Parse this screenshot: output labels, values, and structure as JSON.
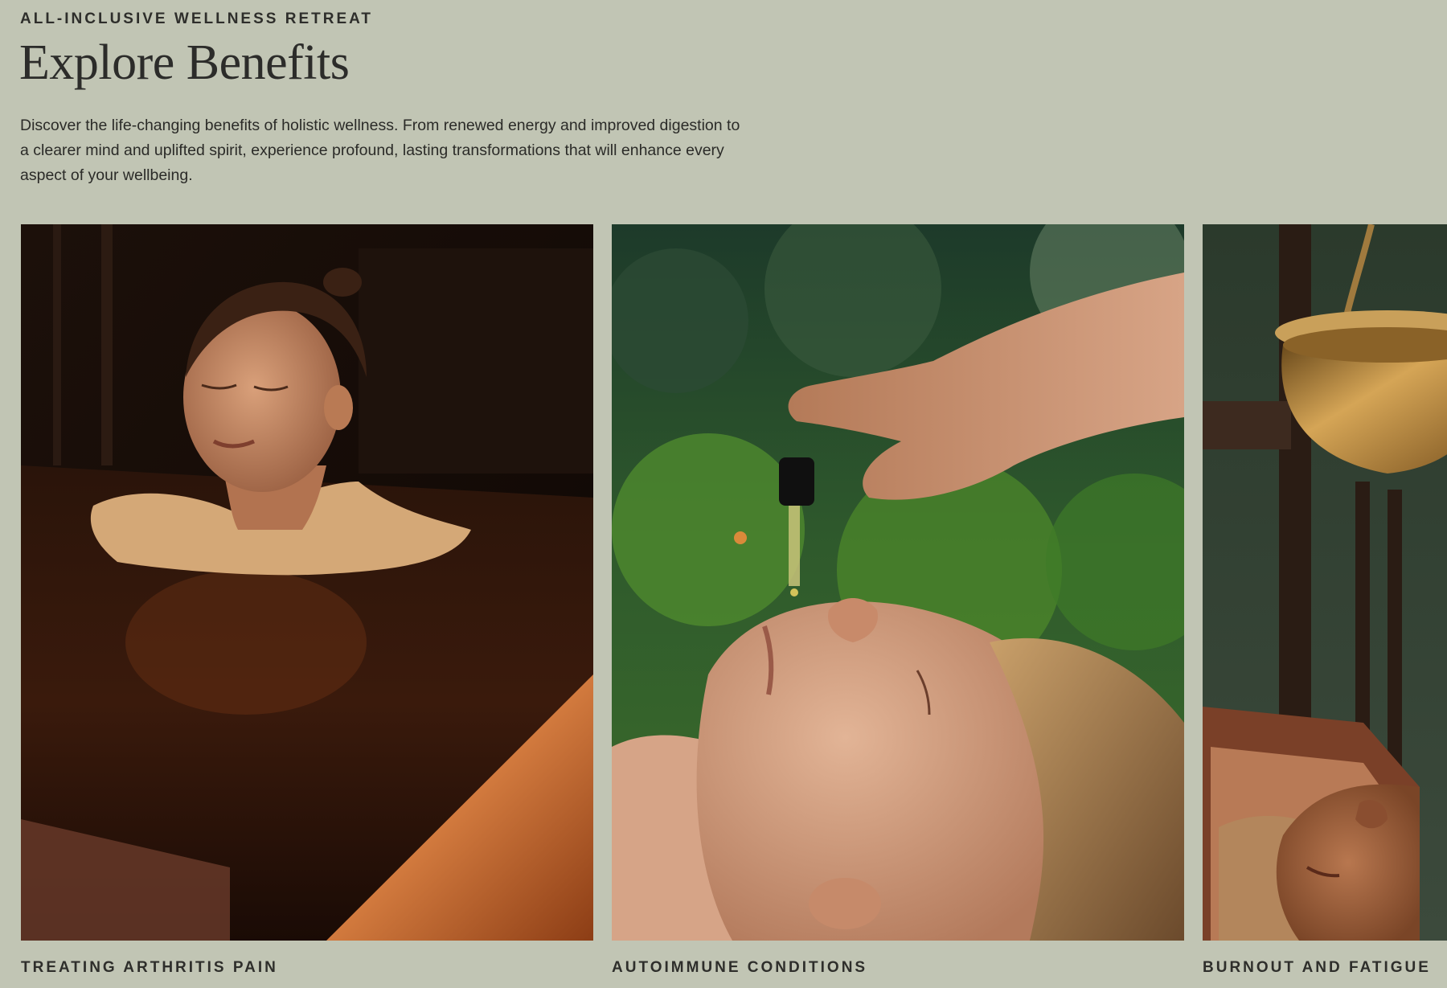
{
  "header": {
    "eyebrow": "ALL-INCLUSIVE WELLNESS RETREAT",
    "title": "Explore Benefits",
    "intro": "Discover the life-changing benefits of holistic wellness. From renewed energy and improved digestion to a clearer mind and uplifted spirit, experience profound, lasting transformations that will enhance every aspect of your wellbeing."
  },
  "cards": [
    {
      "label": "TREATING ARTHRITIS PAIN",
      "image": "woman-in-steam-box-photo"
    },
    {
      "label": "AUTOIMMUNE CONDITIONS",
      "image": "nasal-oil-drops-photo"
    },
    {
      "label": "BURNOUT AND FATIGUE",
      "image": "shirodhara-brass-vessel-photo"
    }
  ],
  "colors": {
    "background": "#c1c5b4",
    "text": "#2e2e2b"
  }
}
